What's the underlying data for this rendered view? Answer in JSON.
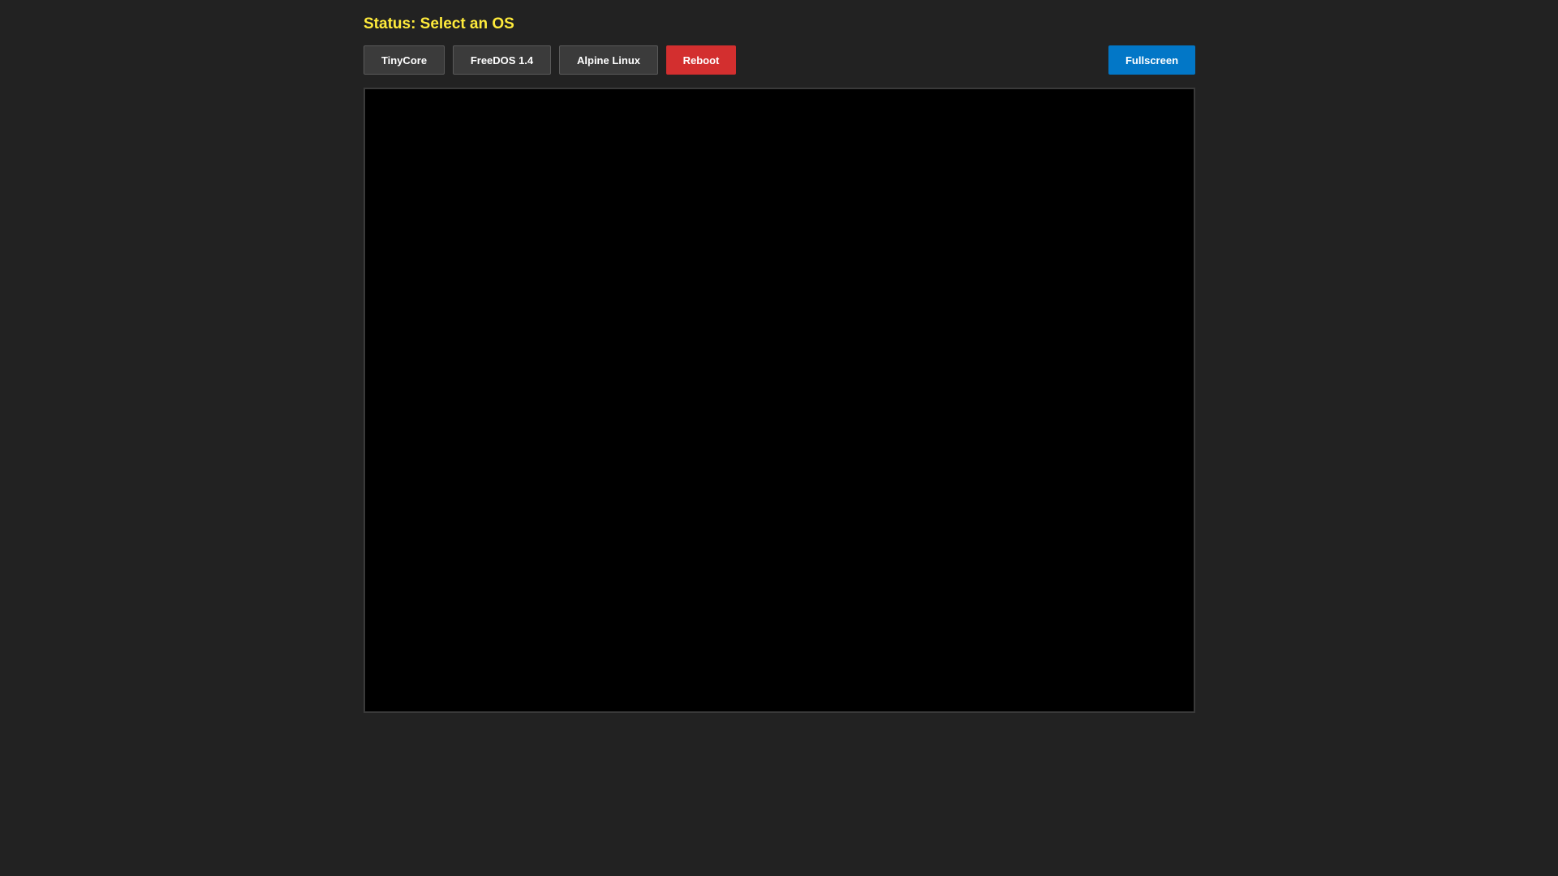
{
  "status": {
    "text": "Status: Select an OS"
  },
  "toolbar": {
    "os_buttons": [
      {
        "label": "TinyCore"
      },
      {
        "label": "FreeDOS 1.4"
      },
      {
        "label": "Alpine Linux"
      }
    ],
    "reboot_label": "Reboot",
    "fullscreen_label": "Fullscreen"
  },
  "colors": {
    "background": "#222222",
    "status_text": "#ffeb3b",
    "button_default": "#3b3b3b",
    "reboot": "#d32f2f",
    "fullscreen": "#0277c7",
    "screen": "#000000"
  }
}
